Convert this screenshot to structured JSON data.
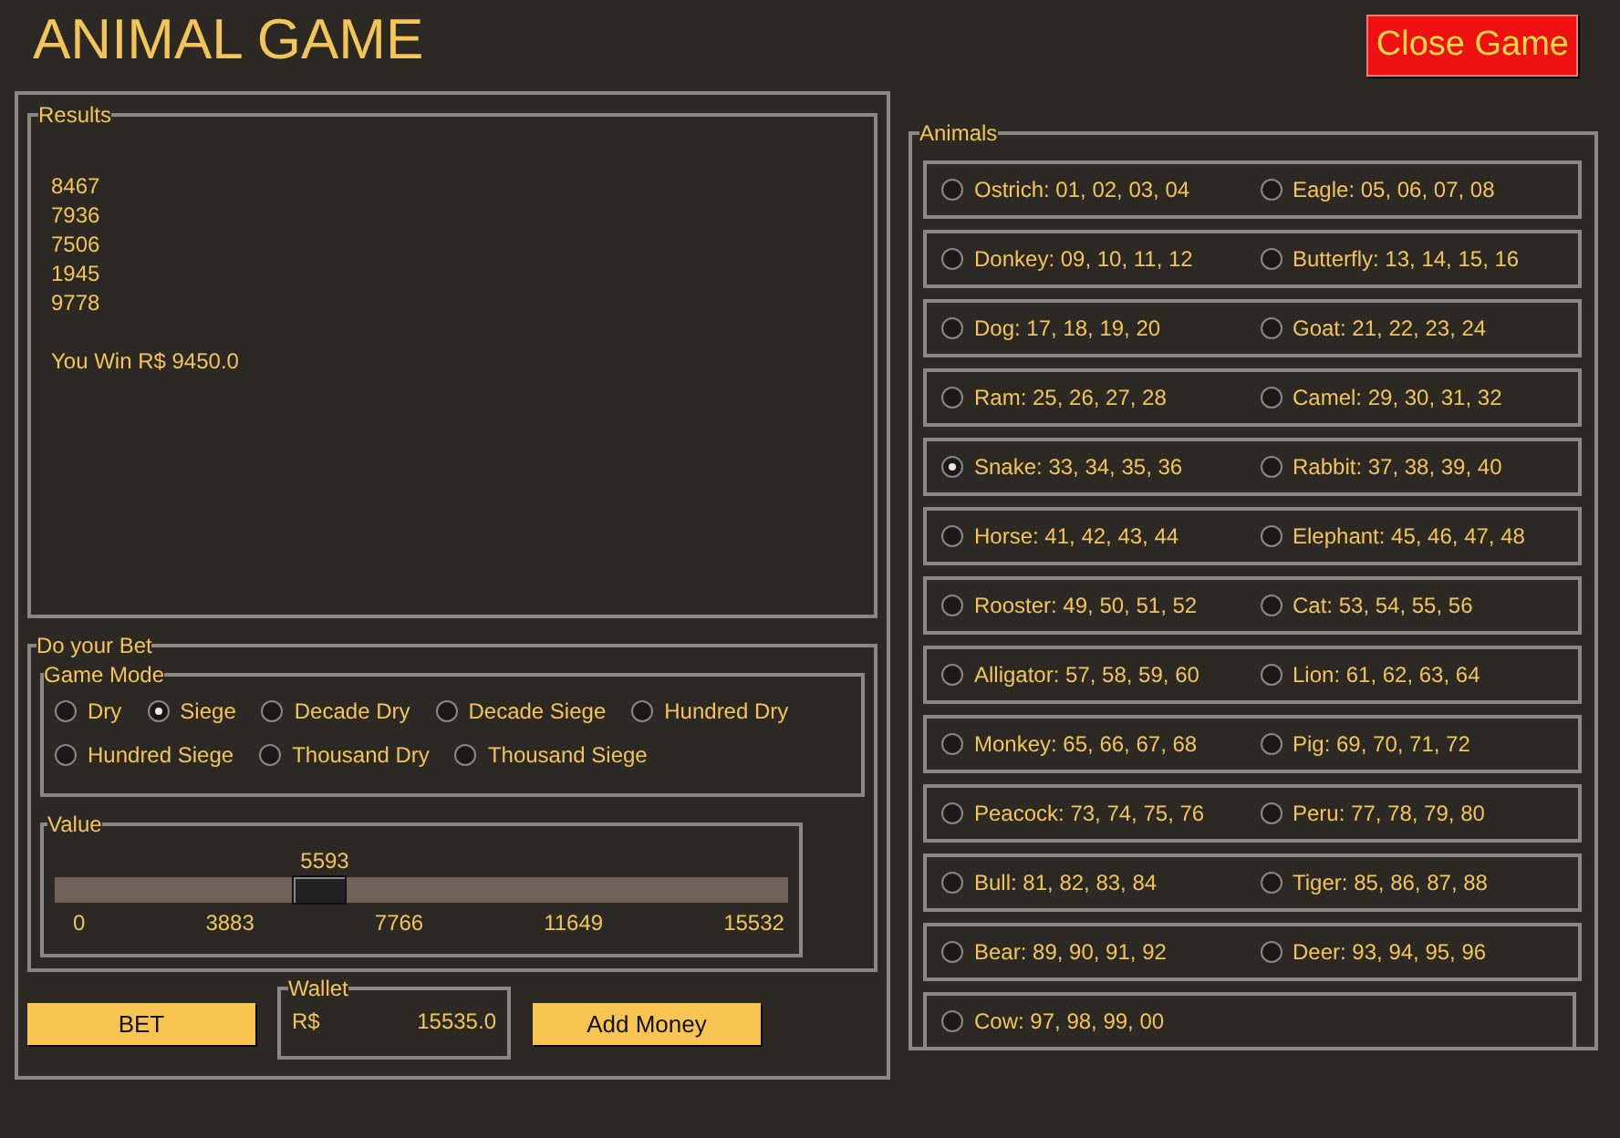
{
  "window": {
    "title": "ANIMAL GAME",
    "close_button": "Close Game"
  },
  "results": {
    "label": "Results",
    "lines": [
      "8467",
      "7936",
      "7506",
      "1945",
      "9778"
    ],
    "message": "You Win R$ 9450.0"
  },
  "bet": {
    "label": "Do your Bet",
    "game_mode": {
      "label": "Game Mode",
      "options": [
        {
          "label": "Dry",
          "selected": false
        },
        {
          "label": "Siege",
          "selected": true
        },
        {
          "label": "Decade Dry",
          "selected": false
        },
        {
          "label": "Decade Siege",
          "selected": false
        },
        {
          "label": "Hundred Dry",
          "selected": false
        },
        {
          "label": "Hundred Siege",
          "selected": false
        },
        {
          "label": "Thousand Dry",
          "selected": false
        },
        {
          "label": "Thousand Siege",
          "selected": false
        }
      ]
    },
    "value": {
      "label": "Value",
      "reading": "5593",
      "level": 0.36,
      "ticks": [
        "0",
        "3883",
        "7766",
        "11649",
        "15532"
      ]
    }
  },
  "bet_button": "BET",
  "wallet": {
    "label": "Wallet",
    "currency": "R$",
    "amount": "15535.0"
  },
  "add_money_button": "Add Money",
  "animals": {
    "label": "Animals",
    "items": [
      {
        "label": "Ostrich: 01, 02, 03, 04",
        "selected": false
      },
      {
        "label": "Eagle: 05, 06, 07, 08",
        "selected": false
      },
      {
        "label": "Donkey: 09, 10, 11, 12",
        "selected": false
      },
      {
        "label": "Butterfly: 13, 14, 15, 16",
        "selected": false
      },
      {
        "label": "Dog: 17, 18, 19, 20",
        "selected": false
      },
      {
        "label": "Goat: 21, 22, 23, 24",
        "selected": false
      },
      {
        "label": "Ram: 25, 26, 27, 28",
        "selected": false
      },
      {
        "label": "Camel: 29, 30, 31, 32",
        "selected": false
      },
      {
        "label": "Snake: 33, 34, 35, 36",
        "selected": true
      },
      {
        "label": "Rabbit: 37, 38, 39, 40",
        "selected": false
      },
      {
        "label": "Horse: 41, 42, 43, 44",
        "selected": false
      },
      {
        "label": "Elephant: 45, 46, 47, 48",
        "selected": false
      },
      {
        "label": "Rooster: 49, 50, 51, 52",
        "selected": false
      },
      {
        "label": "Cat: 53, 54, 55, 56",
        "selected": false
      },
      {
        "label": "Alligator: 57, 58, 59, 60",
        "selected": false
      },
      {
        "label": "Lion: 61, 62, 63, 64",
        "selected": false
      },
      {
        "label": "Monkey: 65, 66, 67, 68",
        "selected": false
      },
      {
        "label": "Pig: 69, 70, 71, 72",
        "selected": false
      },
      {
        "label": "Peacock: 73, 74, 75, 76",
        "selected": false
      },
      {
        "label": "Peru: 77, 78, 79, 80",
        "selected": false
      },
      {
        "label": "Bull: 81, 82, 83, 84",
        "selected": false
      },
      {
        "label": "Tiger: 85, 86, 87, 88",
        "selected": false
      },
      {
        "label": "Bear: 89, 90, 91, 92",
        "selected": false
      },
      {
        "label": "Deer: 93, 94, 95, 96",
        "selected": false
      },
      {
        "label": "Cow: 97, 98, 99, 00",
        "selected": false
      }
    ]
  }
}
